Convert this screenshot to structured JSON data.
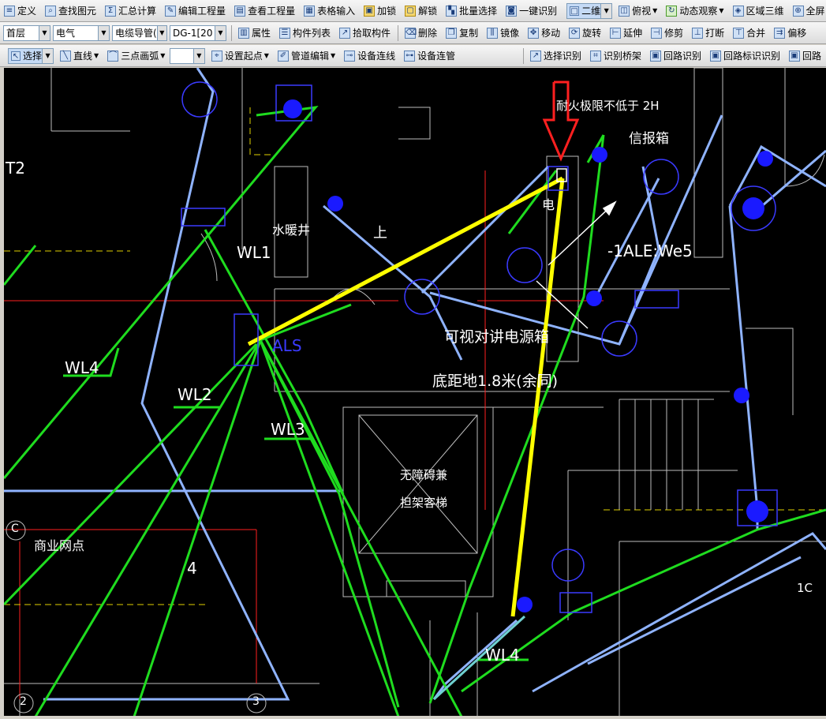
{
  "toolbar1": {
    "items": [
      "定义",
      "查找图元",
      "汇总计算",
      "编辑工程量",
      "查看工程量",
      "表格输入",
      "加锁",
      "解锁",
      "批量选择",
      "一键识别"
    ],
    "view_mode": "二维",
    "view_items": [
      "俯视",
      "动态观察",
      "区域三维",
      "全屏"
    ]
  },
  "toolbar2": {
    "floor": "首层",
    "discipline": "电气",
    "component_type": "电缆导管(",
    "component_name": "DG-1[20",
    "items": [
      "属性",
      "构件列表",
      "拾取构件"
    ],
    "edit_items": [
      "删除",
      "复制",
      "镜像",
      "移动",
      "旋转",
      "延伸",
      "修剪",
      "打断",
      "合并",
      "偏移"
    ]
  },
  "toolbar3": {
    "select_label": "选择",
    "line_label": "直线",
    "arc_label": "三点画弧",
    "arc_combo_value": "",
    "items": [
      "设置起点",
      "管道编辑",
      "设备连线",
      "设备连管"
    ],
    "recognize_items": [
      "选择识别",
      "识别桥架",
      "回路识别",
      "回路标识识别",
      "回路"
    ]
  },
  "cad_labels": {
    "fire_rating": "耐火极限不低于 2H",
    "mailbox": "信报箱",
    "water_shaft": "水暖井",
    "wl1": "WL1",
    "wl2": "WL2",
    "wl3": "WL3",
    "wl4_left": "WL4",
    "wl4_bottom": "WL4",
    "als": "ALS",
    "intercom_box": "可视对讲电源箱",
    "height_note": "底距地1.8米(余同)",
    "ale": "-1ALE:We5",
    "elevator_line1": "无障碍兼",
    "elevator_line2": "担架客梯",
    "commercial": "商业网点",
    "grid_c": "C",
    "grid_2": "2",
    "grid_3": "3",
    "num_4": "4",
    "label_1c": "1C",
    "t2": "T2",
    "shang": "上",
    "elec": "电"
  },
  "colors": {
    "green": "#1fdc1f",
    "yellow": "#ffff00",
    "lightblue": "#8fb3ff",
    "blue": "#1a1aff",
    "red": "#ff2020",
    "white": "#ffffff",
    "gray": "#bdbdbd"
  }
}
